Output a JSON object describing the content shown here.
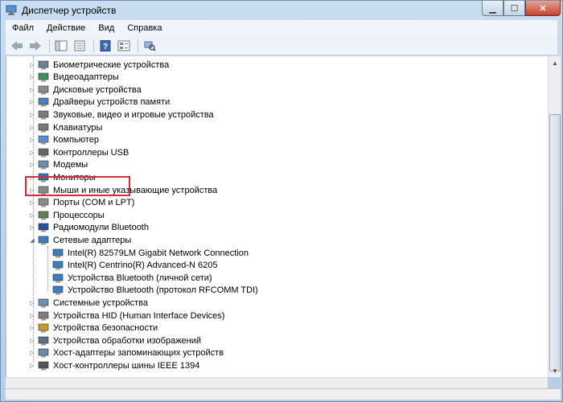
{
  "window": {
    "title": "Диспетчер устройств"
  },
  "menu": [
    "Файл",
    "Действие",
    "Вид",
    "Справка"
  ],
  "tree": [
    {
      "label": "Биометрические устройства",
      "level": 0,
      "icon": "fingerprint-icon"
    },
    {
      "label": "Видеоадаптеры",
      "level": 0,
      "icon": "display-adapter-icon"
    },
    {
      "label": "Дисковые устройства",
      "level": 0,
      "icon": "disk-drive-icon"
    },
    {
      "label": "Драйверы устройств памяти",
      "level": 0,
      "icon": "memory-icon"
    },
    {
      "label": "Звуковые, видео и игровые устройства",
      "level": 0,
      "icon": "speaker-icon"
    },
    {
      "label": "Клавиатуры",
      "level": 0,
      "icon": "keyboard-icon"
    },
    {
      "label": "Компьютер",
      "level": 0,
      "icon": "computer-icon"
    },
    {
      "label": "Контроллеры USB",
      "level": 0,
      "icon": "usb-icon"
    },
    {
      "label": "Модемы",
      "level": 0,
      "icon": "modem-icon"
    },
    {
      "label": "Мониторы",
      "level": 0,
      "icon": "monitor-icon"
    },
    {
      "label": "Мыши и иные указывающие устройства",
      "level": 0,
      "icon": "mouse-icon"
    },
    {
      "label": "Порты (COM и LPT)",
      "level": 0,
      "icon": "port-icon"
    },
    {
      "label": "Процессоры",
      "level": 0,
      "icon": "processor-icon"
    },
    {
      "label": "Радиомодули Bluetooth",
      "level": 0,
      "icon": "bluetooth-icon"
    },
    {
      "label": "Сетевые адаптеры",
      "level": 0,
      "icon": "network-adapter-icon",
      "expanded": true
    },
    {
      "label": "Intel(R) 82579LM Gigabit Network Connection",
      "level": 1,
      "icon": "network-adapter-icon"
    },
    {
      "label": "Intel(R) Centrino(R) Advanced-N 6205",
      "level": 1,
      "icon": "network-adapter-icon"
    },
    {
      "label": "Устройства Bluetooth (личной сети)",
      "level": 1,
      "icon": "network-adapter-icon"
    },
    {
      "label": "Устройство Bluetooth (протокол RFCOMM TDI)",
      "level": 1,
      "icon": "network-adapter-icon"
    },
    {
      "label": "Системные устройства",
      "level": 0,
      "icon": "system-device-icon"
    },
    {
      "label": "Устройства HID (Human Interface Devices)",
      "level": 0,
      "icon": "hid-icon"
    },
    {
      "label": "Устройства безопасности",
      "level": 0,
      "icon": "security-device-icon"
    },
    {
      "label": "Устройства обработки изображений",
      "level": 0,
      "icon": "camera-icon"
    },
    {
      "label": "Хост-адаптеры запоминающих устройств",
      "level": 0,
      "icon": "storage-controller-icon"
    },
    {
      "label": "Хост-контроллеры шины IEEE 1394",
      "level": 0,
      "icon": "ieee1394-icon"
    }
  ],
  "colors": {
    "highlight_border": "#d12e3b",
    "window_frame": "#b6cde6"
  }
}
